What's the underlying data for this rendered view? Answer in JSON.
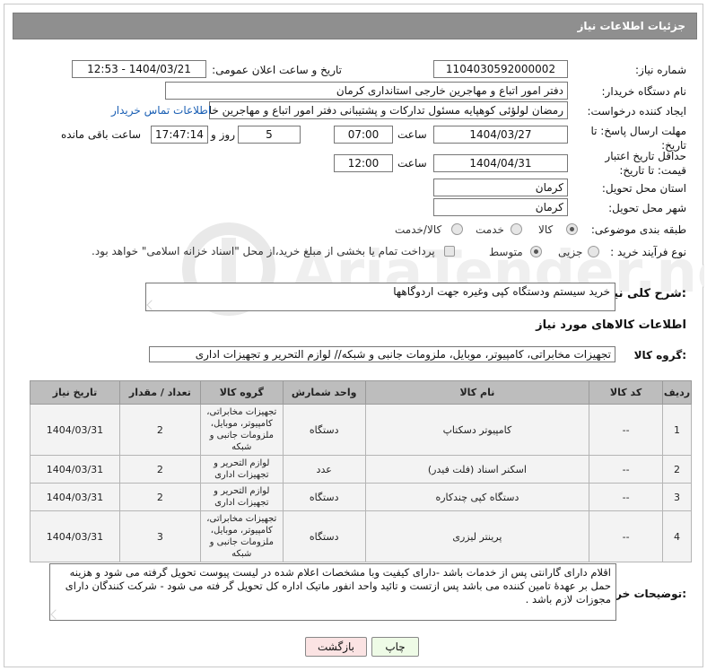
{
  "header": {
    "title": "جزئیات اطلاعات نیاز"
  },
  "labels": {
    "need_number": "شماره نیاز:",
    "announce_datetime": "تاریخ و ساعت اعلان عمومی:",
    "buyer_org": "نام دستگاه خریدار:",
    "requester": "ایجاد کننده درخواست:",
    "reply_deadline": "مهلت ارسال پاسخ: تا تاریخ:",
    "price_validity": "حداقل تاریخ اعتبار قیمت: تا تاریخ:",
    "time_word": "ساعت",
    "day_and": "روز و",
    "hours_remaining": "ساعت باقی مانده",
    "delivery_province": "استان محل تحویل:",
    "delivery_city": "شهر محل تحویل:",
    "category": "طبقه بندی موضوعی:",
    "process_type": "نوع فرآیند خرید :",
    "summary": "شرح کلی نیاز:",
    "goods_info": "اطلاعات کالاهای مورد نیاز",
    "goods_group": "گروه کالا:",
    "buyer_notes": "توضیحات خریدار:"
  },
  "values": {
    "need_number": "1104030592000002",
    "announce_datetime": "1404/03/21 - 12:53",
    "buyer_org": "دفتر  امور اتباع و مهاجرین خارجی استانداری کرمان",
    "requester": "رمضان لولؤئی کوهپایه مسئول تدارکات و پشتیبانی دفتر  امور اتباع و مهاجرین خار",
    "buyer_contact_link": "اطلاعات تماس خریدار",
    "reply_date": "1404/03/27",
    "reply_time": "07:00",
    "reply_days": "5",
    "reply_remaining": "17:47:14",
    "price_date": "1404/04/31",
    "price_time": "12:00",
    "province": "کرمان",
    "city": "کرمان",
    "summary": "خرید سیستم ودستگاه کپی وغیره جهت اردوگاهها",
    "goods_group": "تجهیزات مخابراتی، کامپیوتر، موبایل، ملزومات جانبی و شبکه// لوازم التحریر و تجهیزات اداری",
    "buyer_notes": "اقلام دارای گارانتی پس از خدمات باشد -دارای کیفیت وبا مشخصات اعلام شده در لیست پیوست تحویل گرفته می شود و هزینه حمل بر عهدهٔ تامین کننده می باشد  پس ازتست و تائید واحد انفور ماتیک اداره کل تحویل گر فته می شود - شرکت کنندگان دارای مجوزات لازم باشد ."
  },
  "category_options": [
    {
      "label": "کالا",
      "selected": true
    },
    {
      "label": "خدمت",
      "selected": false
    },
    {
      "label": "کالا/خدمت",
      "selected": false
    }
  ],
  "process_options": [
    {
      "label": "جزیی",
      "selected": false
    },
    {
      "label": "متوسط",
      "selected": true
    }
  ],
  "payment_note": "پرداخت تمام یا بخشی از مبلغ خرید،از محل \"اسناد خزانه اسلامی\" خواهد بود.",
  "table": {
    "headers": [
      "ردیف",
      "کد کالا",
      "نام کالا",
      "واحد شمارش",
      "گروه کالا",
      "تعداد / مقدار",
      "تاریخ نیاز"
    ],
    "rows": [
      [
        "1",
        "--",
        "کامپیوتر دسکتاپ",
        "دستگاه",
        "تجهیزات مخابراتی، کامپیوتر، موبایل، ملزومات جانبی و شبکه",
        "2",
        "1404/03/31"
      ],
      [
        "2",
        "--",
        "اسکنر اسناد (فلت فیدر)",
        "عدد",
        "لوازم التحریر و تجهیزات اداری",
        "2",
        "1404/03/31"
      ],
      [
        "3",
        "--",
        "دستگاه کپی چندکاره",
        "دستگاه",
        "لوازم التحریر و تجهیزات اداری",
        "2",
        "1404/03/31"
      ],
      [
        "4",
        "--",
        "پرینتر لیزری",
        "دستگاه",
        "تجهیزات مخابراتی، کامپیوتر، موبایل، ملزومات جانبی و شبکه",
        "3",
        "1404/03/31"
      ]
    ]
  },
  "buttons": {
    "print": "چاپ",
    "back": "بازگشت"
  },
  "colors": {
    "header_bg": "#8f8f8f",
    "table_header_bg": "#bdbdbd",
    "link": "#1a5fb4"
  }
}
